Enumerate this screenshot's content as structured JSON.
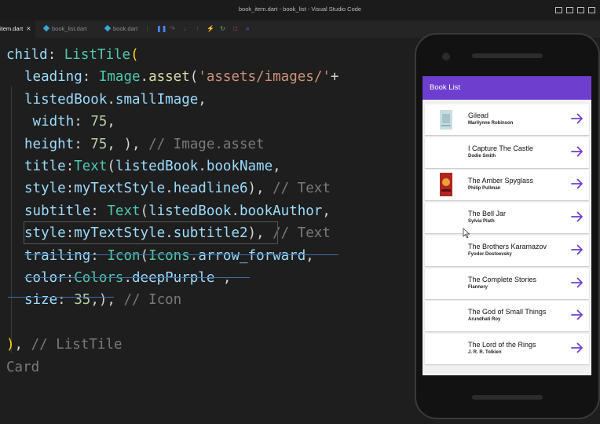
{
  "window": {
    "title": "book_item.dart - book_list - Visual Studio Code"
  },
  "tabs": [
    {
      "label": "item.dart",
      "active": true
    },
    {
      "label": "book_list.dart",
      "active": false
    },
    {
      "label": "book.dart",
      "active": false
    }
  ],
  "code_lines": [
    [
      [
        "kw",
        "child"
      ],
      [
        "plain",
        ": "
      ],
      [
        "cls",
        "ListTile"
      ],
      [
        "brk",
        "("
      ]
    ],
    [
      [
        "kw",
        "leading"
      ],
      [
        "plain",
        ": "
      ],
      [
        "cls",
        "Image"
      ],
      [
        "plain",
        "."
      ],
      [
        "fn",
        "asset"
      ],
      [
        "plain",
        "("
      ],
      [
        "str",
        "'assets/images/'"
      ],
      [
        "plain",
        "+"
      ]
    ],
    [
      [
        "kw",
        "listedBook"
      ],
      [
        "plain",
        "."
      ],
      [
        "kw",
        "smallImage"
      ],
      [
        "plain",
        ","
      ]
    ],
    [
      [
        "plain",
        " "
      ],
      [
        "kw",
        "width"
      ],
      [
        "plain",
        ": "
      ],
      [
        "num",
        "75"
      ],
      [
        "plain",
        ","
      ]
    ],
    [
      [
        "kw",
        "height"
      ],
      [
        "plain",
        ": "
      ],
      [
        "num",
        "75"
      ],
      [
        "plain",
        ", ), "
      ],
      [
        "cmt",
        "// Image.asset"
      ]
    ],
    [
      [
        "kw",
        "title"
      ],
      [
        "plain",
        ":"
      ],
      [
        "cls",
        "Text"
      ],
      [
        "plain",
        "("
      ],
      [
        "kw",
        "listedBook"
      ],
      [
        "plain",
        "."
      ],
      [
        "kw",
        "bookName"
      ],
      [
        "plain",
        ","
      ]
    ],
    [
      [
        "kw",
        "style"
      ],
      [
        "plain",
        ":"
      ],
      [
        "kw",
        "myTextStyle"
      ],
      [
        "plain",
        "."
      ],
      [
        "kw",
        "headline6"
      ],
      [
        "plain",
        "), "
      ],
      [
        "cmt",
        "// Text"
      ]
    ],
    [
      [
        "kw",
        "subtitle"
      ],
      [
        "plain",
        ": "
      ],
      [
        "cls",
        "Text"
      ],
      [
        "plain",
        "("
      ],
      [
        "kw",
        "listedBook"
      ],
      [
        "plain",
        "."
      ],
      [
        "kw",
        "bookAuthor"
      ],
      [
        "plain",
        ","
      ]
    ],
    [
      [
        "kw",
        "style"
      ],
      [
        "plain",
        ":"
      ],
      [
        "kw",
        "myTextStyle"
      ],
      [
        "plain",
        "."
      ],
      [
        "kw",
        "subtitle2"
      ],
      [
        "plain",
        "), "
      ],
      [
        "cmt",
        "// Text"
      ]
    ],
    [
      [
        "kw",
        "trailing"
      ],
      [
        "plain",
        ": "
      ],
      [
        "cls",
        "Icon"
      ],
      [
        "plain",
        "("
      ],
      [
        "cls",
        "Icons"
      ],
      [
        "plain",
        "."
      ],
      [
        "kw",
        "arrow_forward"
      ],
      [
        "plain",
        ","
      ]
    ],
    [
      [
        "kw",
        "color"
      ],
      [
        "plain",
        ":"
      ],
      [
        "cls",
        "Colors"
      ],
      [
        "plain",
        "."
      ],
      [
        "kw",
        "deepPurple"
      ],
      [
        "plain",
        " ,"
      ]
    ],
    [
      [
        "kw",
        "size"
      ],
      [
        "plain",
        ": "
      ],
      [
        "num",
        "35"
      ],
      [
        "plain",
        ",), "
      ],
      [
        "cmt",
        "// Icon"
      ]
    ],
    [],
    [
      [
        "brk",
        ")"
      ],
      [
        "plain",
        ", "
      ],
      [
        "cmt",
        "// ListTile"
      ]
    ],
    [
      [
        "cmt",
        "Card"
      ]
    ]
  ],
  "app": {
    "title": "Book List",
    "books": [
      {
        "title": "Gilead",
        "author": "Marilynne Robinson",
        "thumb": "cover-light"
      },
      {
        "title": "I Capture The Castle",
        "author": "Dodie Smith",
        "thumb": "none"
      },
      {
        "title": "The Amber Spyglass",
        "author": "Philip Pullman",
        "thumb": "cover-red"
      },
      {
        "title": "The Bell Jar",
        "author": "Sylvia Plath",
        "thumb": "none"
      },
      {
        "title": "The Brothers Karamazov",
        "author": "Fyodor Dostoevsky",
        "thumb": "none"
      },
      {
        "title": "The Complete Stories",
        "author": "Flannery",
        "thumb": "none"
      },
      {
        "title": "The God of Small Things",
        "author": "Arundhati Roy",
        "thumb": "none"
      },
      {
        "title": "The Lord of the Rings",
        "author": "J. R. R. Tolkien",
        "thumb": "none"
      }
    ]
  },
  "colors": {
    "app_bar": "#6e3fcf",
    "arrow": "#6e3fcf"
  }
}
